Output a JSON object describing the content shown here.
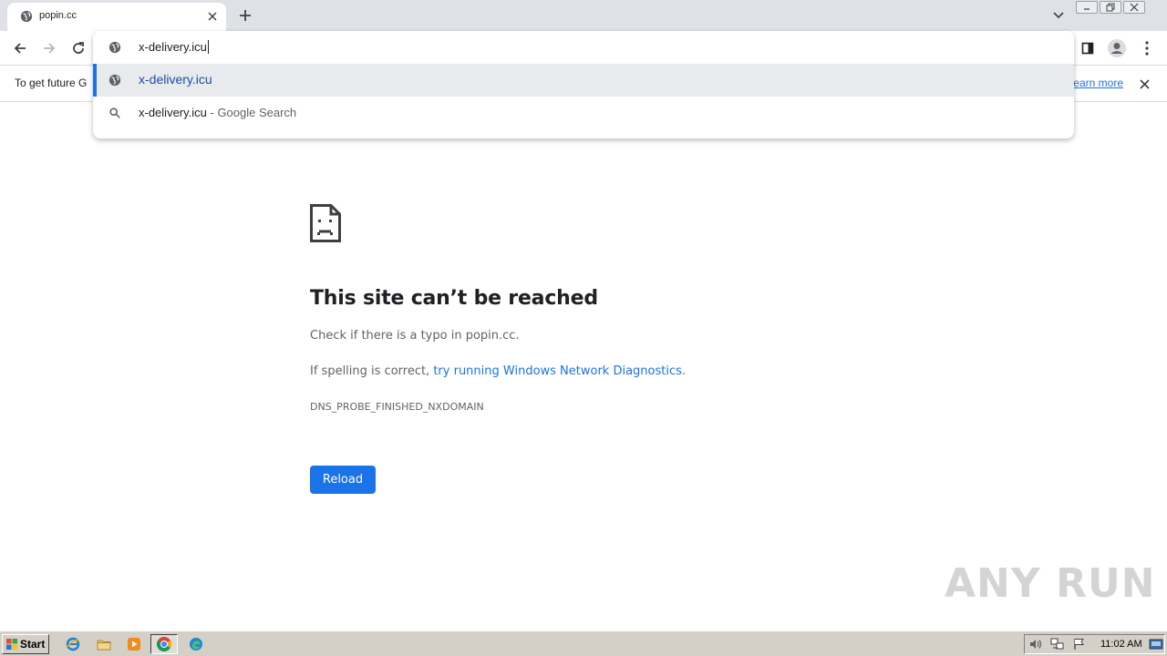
{
  "tab": {
    "title": "popin.cc"
  },
  "omnibox": {
    "input_value": "x-delivery.icu",
    "suggestions": [
      {
        "text": "x-delivery.icu",
        "icon": "globe-icon"
      },
      {
        "text": "x-delivery.icu",
        "suffix": " - Google Search",
        "icon": "search-icon"
      }
    ]
  },
  "infobar": {
    "text": "To get future G",
    "learn_more": "earn more"
  },
  "error": {
    "title": "This site can’t be reached",
    "line1": "Check if there is a typo in popin.cc.",
    "line2_prefix": "If spelling is correct, ",
    "line2_link": "try running Windows Network Diagnostics",
    "line2_suffix": ".",
    "code": "DNS_PROBE_FINISHED_NXDOMAIN",
    "reload_label": "Reload"
  },
  "watermark": {
    "text": "ANY RUN"
  },
  "taskbar": {
    "start_label": "Start",
    "clock": "11:02 AM"
  },
  "colors": {
    "accent": "#1a73e8",
    "tabstrip": "#dee1e6",
    "taskbar": "#d4d0c8"
  }
}
